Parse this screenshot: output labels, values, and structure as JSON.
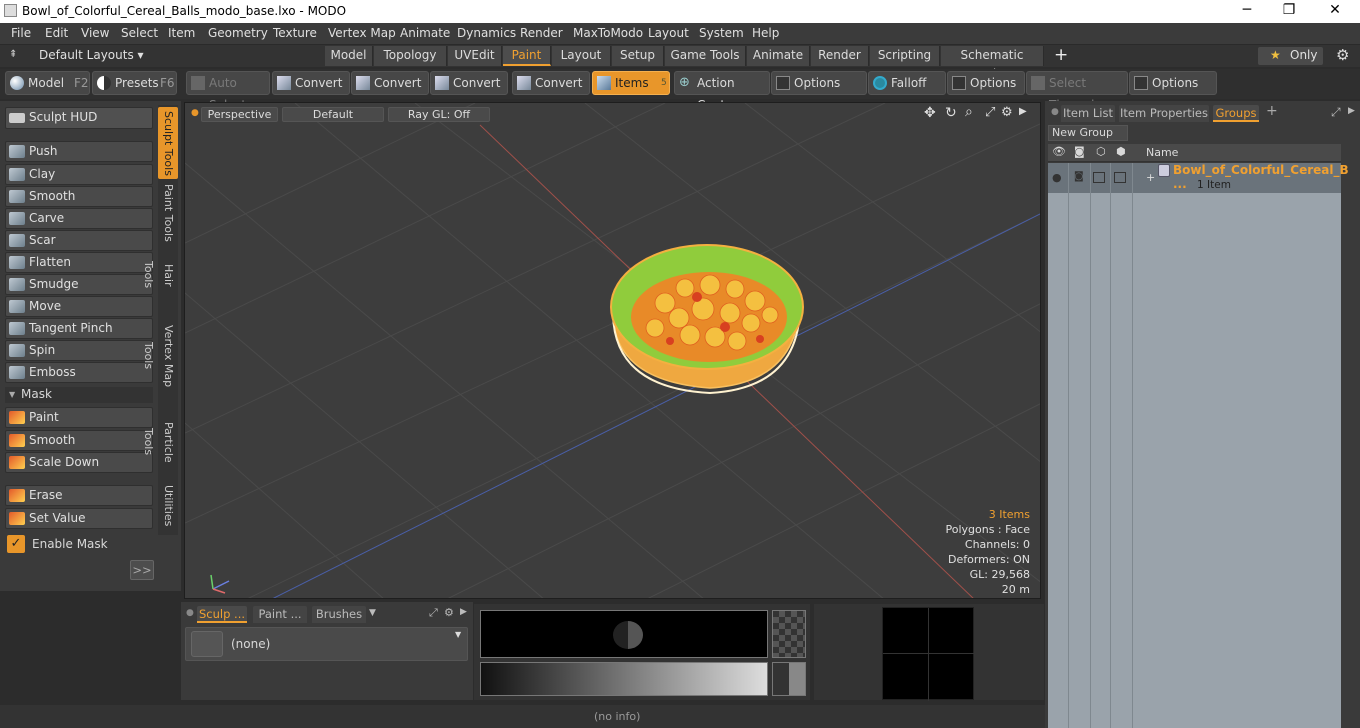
{
  "window": {
    "title": "Bowl_of_Colorful_Cereal_Balls_modo_base.lxo - MODO",
    "minimize": "─",
    "maximize": "❐",
    "close": "✕"
  },
  "menu": [
    "File",
    "Edit",
    "View",
    "Select",
    "Item",
    "Geometry",
    "Texture",
    "Vertex Map",
    "Animate",
    "Dynamics",
    "Render",
    "MaxToModo",
    "Layout",
    "System",
    "Help"
  ],
  "layouts": {
    "default_layouts": "Default Layouts ▾",
    "tabs": [
      "Model",
      "Topology",
      "UVEdit",
      "Paint",
      "Layout",
      "Setup",
      "Game Tools",
      "Animate",
      "Render",
      "Scripting",
      "Schematic Fusion"
    ],
    "active_tab": "Paint",
    "add": "+",
    "only": "Only",
    "star": "★"
  },
  "toolbar": {
    "model": "Model",
    "model_key": "F2",
    "presets": "Presets",
    "presets_key": "F6",
    "auto_select": "Auto Select",
    "convert": "Convert",
    "items": "Items",
    "items_key": "5",
    "action_center": "Action Center",
    "options": "Options",
    "falloff": "Falloff",
    "select_through": "Select Through"
  },
  "left": {
    "sculpt_hud": "Sculpt HUD",
    "tools": [
      "Push",
      "Clay",
      "Smooth",
      "Carve",
      "Scar",
      "Flatten",
      "Smudge",
      "Move",
      "Tangent Pinch",
      "Spin",
      "Emboss"
    ],
    "mask_header": "Mask",
    "mask_tools": [
      "Paint",
      "Smooth",
      "Scale Down"
    ],
    "erase": "Erase",
    "set_value": "Set Value",
    "enable_mask": "Enable Mask",
    "expand": ">>",
    "vtabs": [
      "Sculpt Tools",
      "Paint Tools",
      "Hair Tools",
      "Vertex Map Tools",
      "Particle Tools",
      "Utilities"
    ]
  },
  "viewport": {
    "perspective": "Perspective",
    "default": "Default",
    "raygl": "Ray GL: Off",
    "stats": {
      "items": "3 Items",
      "polygons": "Polygons : Face",
      "channels": "Channels: 0",
      "deformers": "Deformers: ON",
      "gl": "GL: 29,568",
      "scale": "20 m"
    }
  },
  "right": {
    "tabs": [
      "Item List",
      "Item Properties",
      "Groups"
    ],
    "active_tab": "Groups",
    "add": "+",
    "new_group": "New Group",
    "col_name": "Name",
    "group_name": "Bowl_of_Colorful_Cereal_B ...",
    "group_count": "1 Item",
    "expand": "+"
  },
  "bottom": {
    "tabs": [
      "Sculp ...",
      "Paint ...",
      "Brushes"
    ],
    "none": "(none)",
    "status": "(no info)"
  },
  "colors": {
    "accent": "#e8962a",
    "bowl_green": "#8fce3a",
    "bowl_orange": "#f2a02c"
  }
}
